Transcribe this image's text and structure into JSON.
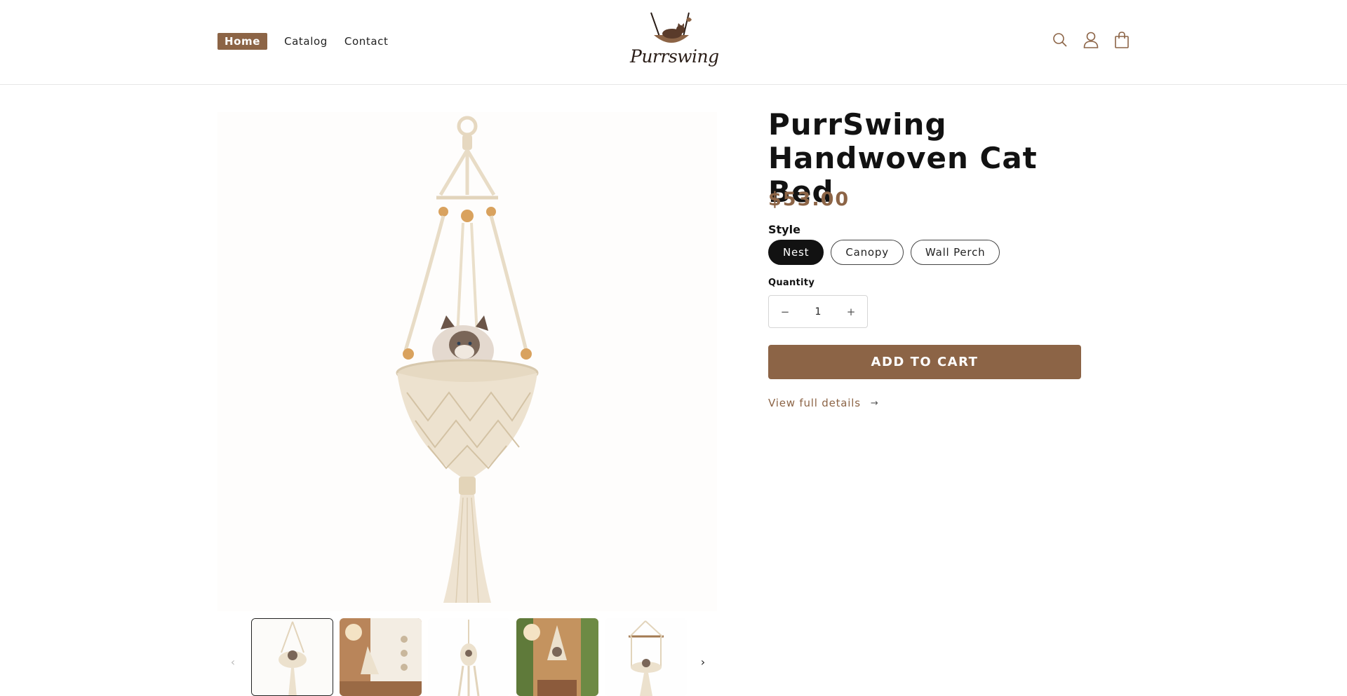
{
  "header": {
    "nav": [
      {
        "label": "Home",
        "active": true
      },
      {
        "label": "Catalog",
        "active": false
      },
      {
        "label": "Contact",
        "active": false
      }
    ],
    "logo_text": "Purrswing",
    "icons": [
      "search-icon",
      "account-icon",
      "cart-icon"
    ]
  },
  "product": {
    "title": "PurrSwing Handwoven Cat Bed",
    "price": "$53.00",
    "style_label": "Style",
    "styles": [
      {
        "label": "Nest",
        "selected": true
      },
      {
        "label": "Canopy",
        "selected": false
      },
      {
        "label": "Wall Perch",
        "selected": false
      }
    ],
    "quantity_label": "Quantity",
    "quantity": "1",
    "decrease_symbol": "−",
    "increase_symbol": "+",
    "add_to_cart": "ADD TO CART",
    "view_details": "View full details",
    "view_details_arrow": "→"
  },
  "gallery": {
    "prev_symbol": "‹",
    "next_symbol": "›",
    "thumbnail_count": 5,
    "selected_thumbnail": 1
  },
  "colors": {
    "brand": "#8c6446",
    "macrame": "#ecdfc9",
    "bead": "#d9a25e",
    "selected_pill": "#121212"
  }
}
